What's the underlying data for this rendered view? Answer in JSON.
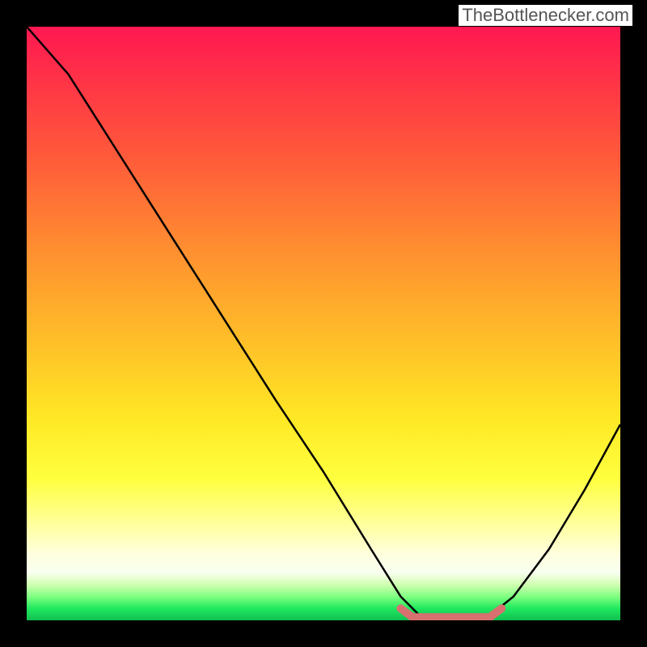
{
  "watermark": "TheBottlenecker.com",
  "chart_data": {
    "type": "line",
    "title": "",
    "xlabel": "",
    "ylabel": "",
    "xlim": [
      0,
      100
    ],
    "ylim": [
      0,
      100
    ],
    "series": [
      {
        "name": "bottleneck-curve",
        "x": [
          0,
          7,
          14,
          21,
          28,
          35,
          42,
          50,
          58,
          63,
          67,
          72,
          77,
          82,
          88,
          94,
          100
        ],
        "values": [
          100,
          92,
          81,
          70,
          59,
          48,
          37,
          25,
          12,
          4,
          0,
          0,
          0,
          4,
          12,
          22,
          33
        ]
      },
      {
        "name": "optimal-zone-marker",
        "x": [
          63,
          65,
          70,
          75,
          78,
          80
        ],
        "values": [
          2,
          0.5,
          0.5,
          0.5,
          0.5,
          2
        ]
      }
    ],
    "gradient_stops": [
      {
        "pos": 0,
        "color": "#ff1850"
      },
      {
        "pos": 22,
        "color": "#ff5a3a"
      },
      {
        "pos": 54,
        "color": "#ffc228"
      },
      {
        "pos": 76,
        "color": "#ffff3e"
      },
      {
        "pos": 92,
        "color": "#f8ffef"
      },
      {
        "pos": 100,
        "color": "#10c050"
      }
    ]
  }
}
